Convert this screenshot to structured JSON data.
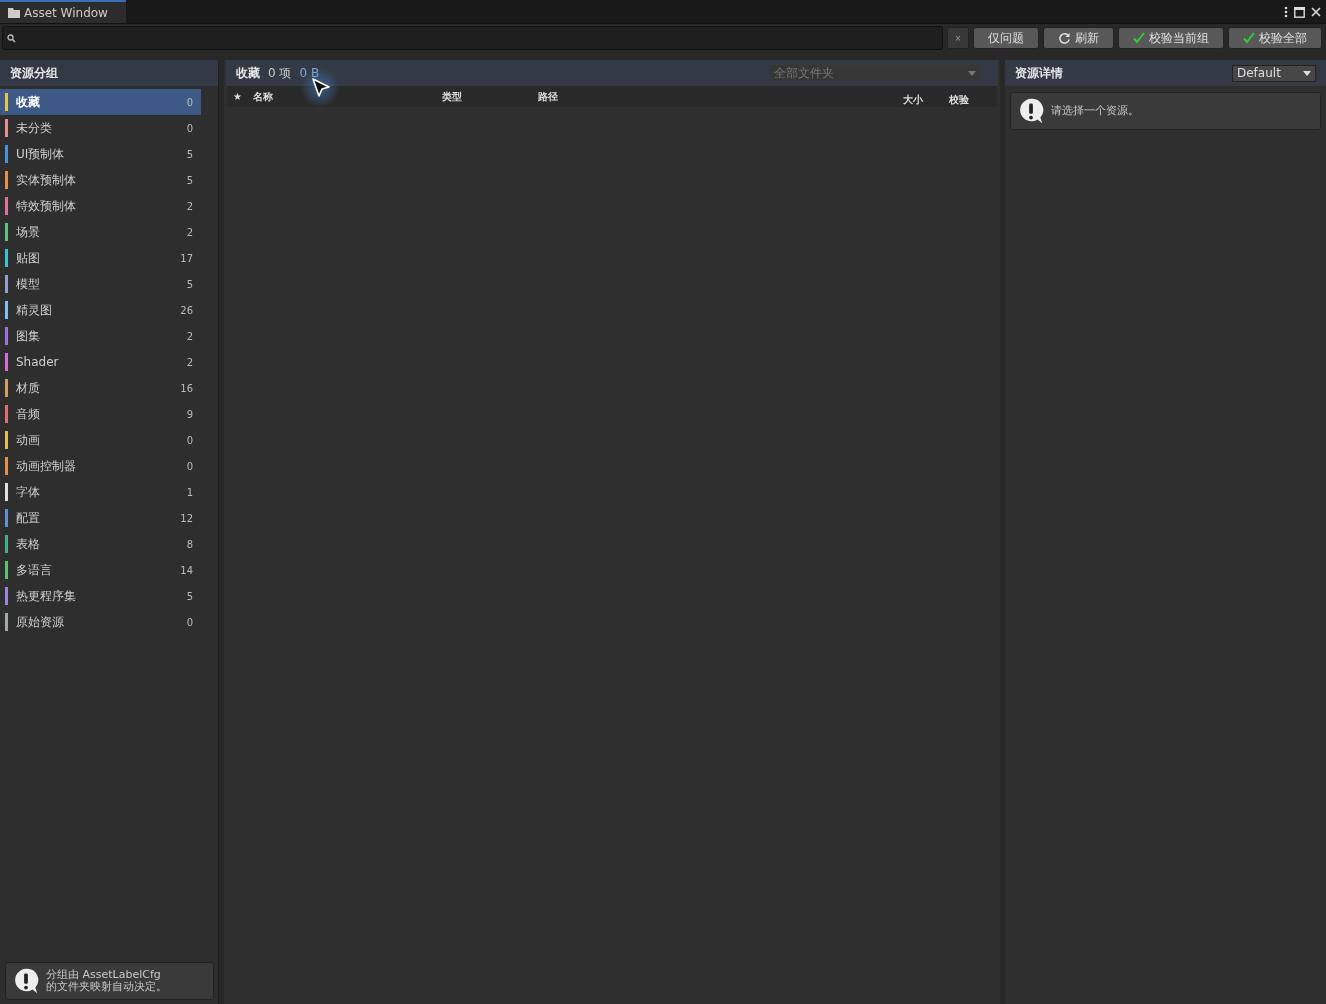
{
  "window": {
    "title": "Asset Window"
  },
  "toolbar": {
    "clear_label": "×",
    "buttons": [
      {
        "kind": "plain",
        "label": "仅问题"
      },
      {
        "kind": "refresh",
        "label": "刷新"
      },
      {
        "kind": "check",
        "label": "校验当前组"
      },
      {
        "kind": "check",
        "label": "校验全部"
      }
    ]
  },
  "groups_panel": {
    "title": "资源分组",
    "items": [
      {
        "label": "收藏",
        "count": "0",
        "color": "#e8c547",
        "selected": true
      },
      {
        "label": "未分类",
        "count": "0",
        "color": "#e89090",
        "selected": false
      },
      {
        "label": "UI预制体",
        "count": "5",
        "color": "#4a8fe0",
        "selected": false
      },
      {
        "label": "实体预制体",
        "count": "5",
        "color": "#e8904a",
        "selected": false
      },
      {
        "label": "特效预制体",
        "count": "2",
        "color": "#e070a0",
        "selected": false
      },
      {
        "label": "场景",
        "count": "2",
        "color": "#60c080",
        "selected": false
      },
      {
        "label": "贴图",
        "count": "17",
        "color": "#40c0d0",
        "selected": false
      },
      {
        "label": "模型",
        "count": "5",
        "color": "#8fa0d0",
        "selected": false
      },
      {
        "label": "精灵图",
        "count": "26",
        "color": "#80c0f0",
        "selected": false
      },
      {
        "label": "图集",
        "count": "2",
        "color": "#a070e0",
        "selected": false
      },
      {
        "label": "Shader",
        "count": "2",
        "color": "#d070d0",
        "selected": false
      },
      {
        "label": "材质",
        "count": "16",
        "color": "#d0a060",
        "selected": false
      },
      {
        "label": "音频",
        "count": "9",
        "color": "#e07070",
        "selected": false
      },
      {
        "label": "动画",
        "count": "0",
        "color": "#e0c050",
        "selected": false
      },
      {
        "label": "动画控制器",
        "count": "0",
        "color": "#e09050",
        "selected": false
      },
      {
        "label": "字体",
        "count": "1",
        "color": "#e0e0e0",
        "selected": false
      },
      {
        "label": "配置",
        "count": "12",
        "color": "#6090d0",
        "selected": false
      },
      {
        "label": "表格",
        "count": "8",
        "color": "#40b090",
        "selected": false
      },
      {
        "label": "多语言",
        "count": "14",
        "color": "#60c070",
        "selected": false
      },
      {
        "label": "热更程序集",
        "count": "5",
        "color": "#a080e0",
        "selected": false
      },
      {
        "label": "原始资源",
        "count": "0",
        "color": "#a0a8b0",
        "selected": false
      }
    ],
    "note": "分组由 AssetLabelCfg\n的文件夹映射自动决定。"
  },
  "list_panel": {
    "title": "收藏",
    "item_count": "0 项",
    "total_size": "0 B",
    "folder_dropdown": "全部文件夹",
    "columns": [
      "★",
      "名称",
      "类型",
      "路径",
      "大小",
      "校验"
    ]
  },
  "details_panel": {
    "title": "资源详情",
    "profile_dropdown": "Default",
    "message": "请选择一个资源。"
  }
}
